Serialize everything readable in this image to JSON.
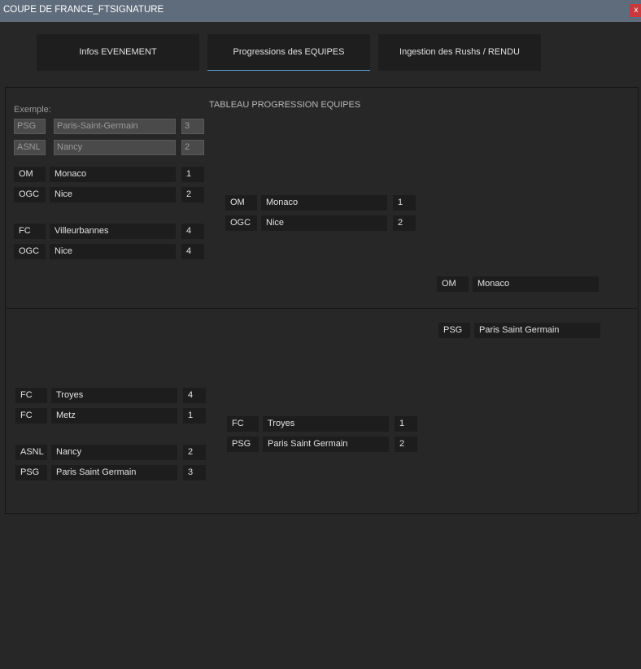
{
  "window": {
    "title": "COUPE DE FRANCE_FTSIGNATURE",
    "close_glyph": "x"
  },
  "tabs": [
    {
      "label": "Infos EVENEMENT"
    },
    {
      "label": "Progressions des EQUIPES"
    },
    {
      "label": "Ingestion des Rushs / RENDU"
    }
  ],
  "example": {
    "label": "Exemple:",
    "rows": [
      {
        "code": "PSG",
        "name": "Paris-Saint-Germain",
        "score": "3"
      },
      {
        "code": "ASNL",
        "name": "Nancy",
        "score": "2"
      }
    ]
  },
  "table_title": "TABLEAU PROGRESSION  EQUIPES",
  "top": {
    "round1": [
      {
        "code": "OM",
        "name": "Monaco",
        "score": "1"
      },
      {
        "code": "OGC",
        "name": "Nice",
        "score": "2"
      },
      {
        "code": "FC",
        "name": "Villeurbannes",
        "score": "4"
      },
      {
        "code": "OGC",
        "name": "Nice",
        "score": "4"
      }
    ],
    "round2": [
      {
        "code": "OM",
        "name": "Monaco",
        "score": "1"
      },
      {
        "code": "OGC",
        "name": "Nice",
        "score": "2"
      }
    ],
    "final": {
      "code": "OM",
      "name": "Monaco"
    }
  },
  "bottom": {
    "final": {
      "code": "PSG",
      "name": "Paris Saint Germain"
    },
    "round1": [
      {
        "code": "FC",
        "name": "Troyes",
        "score": "4"
      },
      {
        "code": "FC",
        "name": "Metz",
        "score": "1"
      },
      {
        "code": "ASNL",
        "name": "Nancy",
        "score": "2"
      },
      {
        "code": "PSG",
        "name": "Paris Saint Germain",
        "score": "3"
      }
    ],
    "round2": [
      {
        "code": "FC",
        "name": "Troyes",
        "score": "1"
      },
      {
        "code": "PSG",
        "name": "Paris Saint Germain",
        "score": "2"
      }
    ]
  }
}
